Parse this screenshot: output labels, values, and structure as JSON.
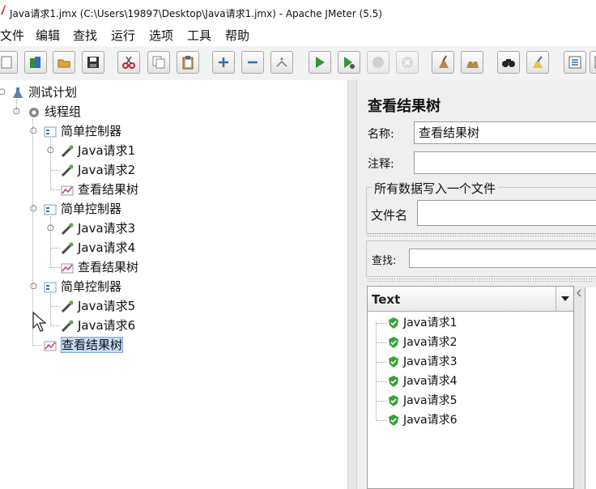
{
  "window": {
    "title": "Java请求1.jmx (C:\\Users\\19897\\Desktop\\Java请求1.jmx) - Apache JMeter (5.5)"
  },
  "menubar": [
    "文件",
    "编辑",
    "查找",
    "运行",
    "选项",
    "工具",
    "帮助"
  ],
  "toolbar": [
    "new-icon",
    "templates-icon",
    "open-icon",
    "save-icon",
    "cut-icon",
    "copy-icon",
    "paste-icon",
    "expand-icon",
    "collapse-icon",
    "toggle-icon",
    "start-icon",
    "start-no-pause-icon",
    "stop-icon",
    "shutdown-icon",
    "clear-icon",
    "clear-all-icon",
    "search-icon",
    "reset-search-icon",
    "function-helper-icon"
  ],
  "tree": {
    "root": "测试计划",
    "thread_group": "线程组",
    "controllers": [
      {
        "label": "简单控制器",
        "children": [
          "Java请求1",
          "Java请求2",
          "查看结果树"
        ]
      },
      {
        "label": "简单控制器",
        "children": [
          "Java请求3",
          "Java请求4",
          "查看结果树"
        ]
      },
      {
        "label": "简单控制器",
        "children": [
          "Java请求5",
          "Java请求6"
        ]
      }
    ],
    "selected": "查看结果树"
  },
  "panel": {
    "heading": "查看结果树",
    "name_label": "名称:",
    "name_value": "查看结果树",
    "comment_label": "注释:",
    "comment_value": "",
    "file_group_title": "所有数据写入一个文件",
    "filename_label": "文件名",
    "search_label": "查找:",
    "results_dropdown": "Text",
    "results": [
      "Java请求1",
      "Java请求2",
      "Java请求3",
      "Java请求4",
      "Java请求5",
      "Java请求6"
    ]
  },
  "colors": {
    "selection": "#c7dcf5",
    "success": "#3aa33a",
    "toolbar_bg": "#f3f3f3"
  }
}
